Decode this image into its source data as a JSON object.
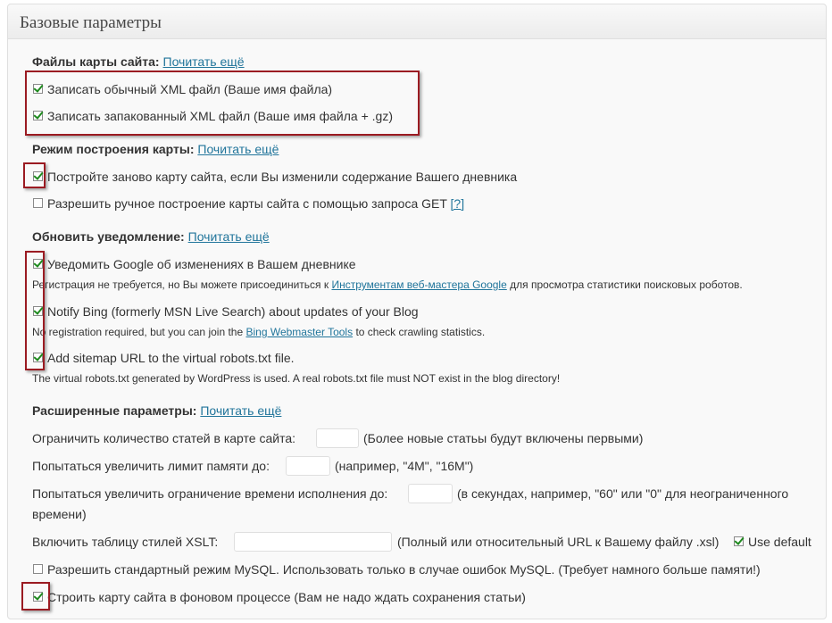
{
  "header": {
    "title": "Базовые параметры"
  },
  "more_link": "Почитать ещё",
  "sitemap_files": {
    "heading": "Файлы карты сайта:",
    "xml": {
      "label": "Записать обычный XML файл (Ваше имя файла)",
      "checked": true
    },
    "gz": {
      "label": "Записать запакованный XML файл (Ваше имя файла + .gz)",
      "checked": true
    }
  },
  "build_mode": {
    "heading": "Режим построения карты:",
    "rebuild": {
      "label": "Постройте заново карту сайта, если Вы изменили содержание Вашего дневника",
      "checked": true
    },
    "manual": {
      "label": "Разрешить ручное построение карты сайта с помощью запроса GET",
      "help": "[?]",
      "checked": false
    }
  },
  "notify": {
    "heading": "Обновить уведомление:",
    "google": {
      "label": "Уведомить Google об изменениях в Вашем дневнике",
      "checked": true,
      "desc_before": "Регистрация не требуется, но Вы можете присоединиться к",
      "desc_link": "Инструментам веб-мастера Google",
      "desc_after": "для просмотра статистики поисковых роботов."
    },
    "bing": {
      "label": "Notify Bing (formerly MSN Live Search) about updates of your Blog",
      "checked": true,
      "desc_before": "No registration required, but you can join the",
      "desc_link": "Bing Webmaster Tools",
      "desc_after": "to check crawling statistics."
    },
    "robots": {
      "label": "Add sitemap URL to the virtual robots.txt file.",
      "checked": true,
      "desc": "The virtual robots.txt generated by WordPress is used. A real robots.txt file must NOT exist in the blog directory!"
    }
  },
  "advanced": {
    "heading": "Расширенные параметры:",
    "limit_posts": {
      "label": "Ограничить количество статей в карте сайта:",
      "value": "",
      "note": "(Более новые статьы будут включены первыми)"
    },
    "memory": {
      "label": "Попытаться увеличить лимит памяти до:",
      "value": "",
      "note": "(например, \"4M\", \"16M\")"
    },
    "time": {
      "label": "Попытаться увеличить ограничение времени исполнения до:",
      "value": "",
      "note_line1": "(в секундах, например, \"60\" или \"0\" для неограниченного",
      "note_line2": "времени)"
    },
    "xslt": {
      "label": "Включить таблицу стилей XSLT:",
      "value": "",
      "note": "(Полный или относительный URL к Вашему файлу .xsl)",
      "use_default": "Use default",
      "use_default_checked": true
    },
    "mysql": {
      "label": "Разрешить стандартный режим MySQL. Использовать только в случае ошибок MySQL. (Требует намного больше памяти!)",
      "checked": false
    },
    "background": {
      "label": "Строить карту сайта в фоновом процессе (Вам не надо ждать сохранения статьи)",
      "checked": true
    }
  },
  "colors": {
    "link": "#21759b",
    "highlight": "#9b1b22",
    "check": "#1e8a1e"
  }
}
